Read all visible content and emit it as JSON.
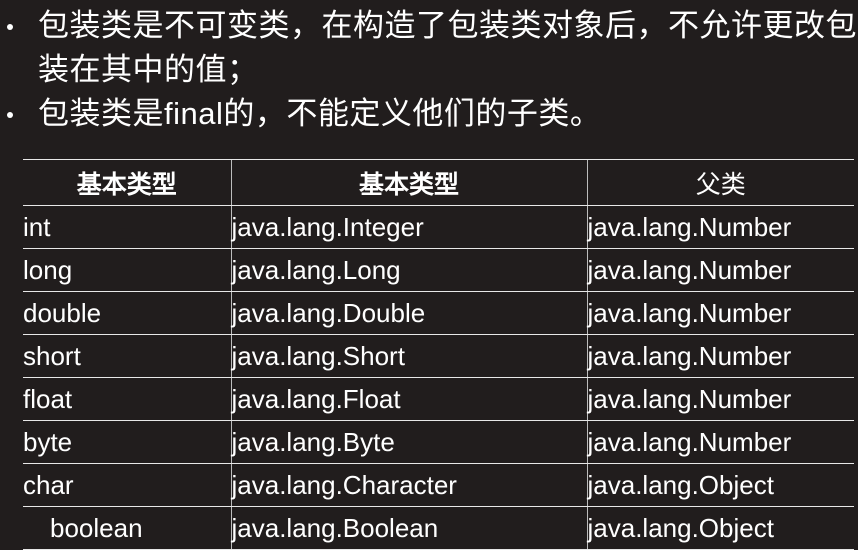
{
  "slide": {
    "background_color": "#211d1d",
    "text_color": "#ffffff",
    "highlight_color": "#ffff00",
    "border_color": "#e8e8e8"
  },
  "bullets": [
    {
      "marker": "bullet-dot",
      "text": "包装类是不可变类，在构造了包装类对象后，不允许更改包装在其中的值；"
    },
    {
      "marker": "bullet-dot",
      "text": "包装类是final的，不能定义他们的子类。"
    }
  ],
  "table": {
    "headers": [
      {
        "label": "基本类型",
        "bold": true,
        "align": "center"
      },
      {
        "label": "基本类型",
        "bold": true,
        "align": "center"
      },
      {
        "label": "父类",
        "bold": false,
        "align": "center"
      }
    ],
    "rows": [
      {
        "primitive": "int",
        "wrapper": "java.lang.Integer",
        "parent": "java.lang.Number",
        "parent_highlight": true,
        "primitive_indent": false
      },
      {
        "primitive": "long",
        "wrapper": "java.lang.Long",
        "parent": "java.lang.Number",
        "parent_highlight": false,
        "primitive_indent": false
      },
      {
        "primitive": "double",
        "wrapper": "java.lang.Double",
        "parent": "java.lang.Number",
        "parent_highlight": false,
        "primitive_indent": false
      },
      {
        "primitive": "short",
        "wrapper": "java.lang.Short",
        "parent": "java.lang.Number",
        "parent_highlight": false,
        "primitive_indent": false
      },
      {
        "primitive": "float",
        "wrapper": "java.lang.Float",
        "parent": "java.lang.Number",
        "parent_highlight": false,
        "primitive_indent": false
      },
      {
        "primitive": "byte",
        "wrapper": "java.lang.Byte",
        "parent": "java.lang.Number",
        "parent_highlight": false,
        "primitive_indent": false
      },
      {
        "primitive": "char",
        "wrapper": "java.lang.Character",
        "parent": "java.lang.Object",
        "parent_highlight": true,
        "primitive_indent": false
      },
      {
        "primitive": "boolean",
        "wrapper": "java.lang.Boolean",
        "parent": "java.lang.Object",
        "parent_highlight": false,
        "primitive_indent": true
      }
    ]
  }
}
